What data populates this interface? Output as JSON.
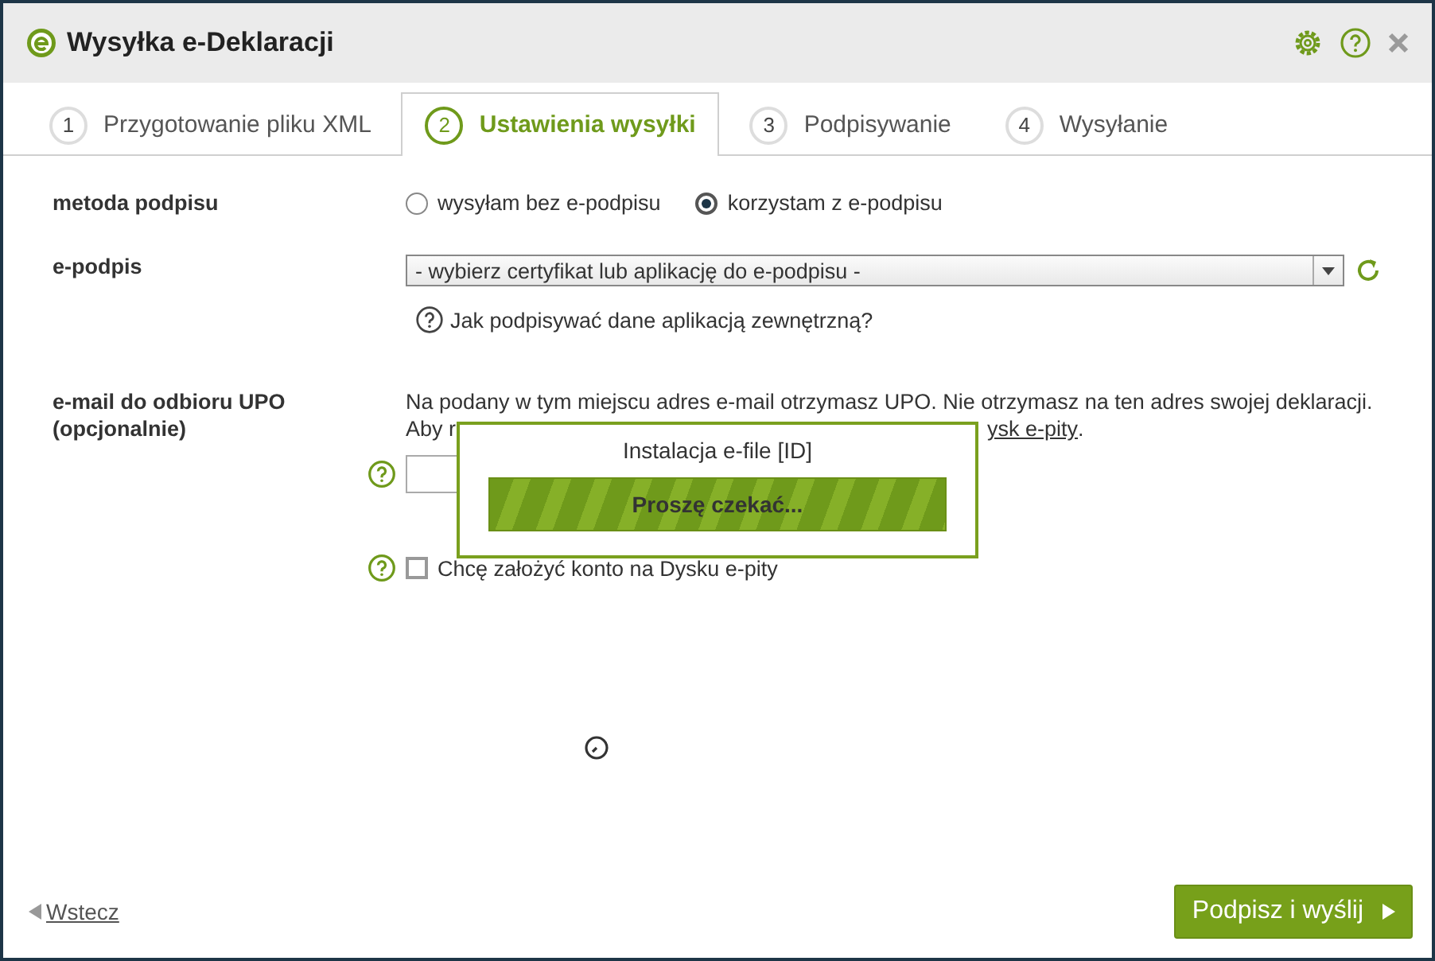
{
  "window": {
    "title": "Wysyłka e-Deklaracji"
  },
  "tabs": [
    {
      "number": "1",
      "label": "Przygotowanie pliku XML",
      "selected": false
    },
    {
      "number": "2",
      "label": "Ustawienia wysyłki",
      "selected": true
    },
    {
      "number": "3",
      "label": "Podpisywanie",
      "selected": false
    },
    {
      "number": "4",
      "label": "Wysyłanie",
      "selected": false
    }
  ],
  "signature_method": {
    "label": "metoda podpisu",
    "options": [
      {
        "label": "wysyłam bez e-podpisu",
        "selected": false
      },
      {
        "label": "korzystam z e-podpisu",
        "selected": true
      }
    ]
  },
  "e_signature": {
    "label": "e-podpis",
    "value": "- wybierz certyfikat lub aplikację do e-podpisu -",
    "help_link": "Jak podpisywać dane aplikacją zewnętrzną?"
  },
  "email": {
    "label": "e-mail do odbioru UPO (opcjonalnie)",
    "info_line_1": "Na podany w tym miejscu adres e-mail otrzymasz UPO. Nie otrzymasz na ten adres swojej deklaracji.",
    "info_line_2_start": "Aby r",
    "info_line_2_link": "ysk e-pity",
    "info_line_2_end": "."
  },
  "create_account": {
    "label": "Chcę założyć konto na Dysku e-pity",
    "checked": false
  },
  "modal": {
    "title": "Instalacja e-file [ID]",
    "progress_text": "Proszę czekać...",
    "level": 1
  },
  "footer": {
    "back": "Wstecz",
    "submit": "Podpisz i wyślij"
  }
}
